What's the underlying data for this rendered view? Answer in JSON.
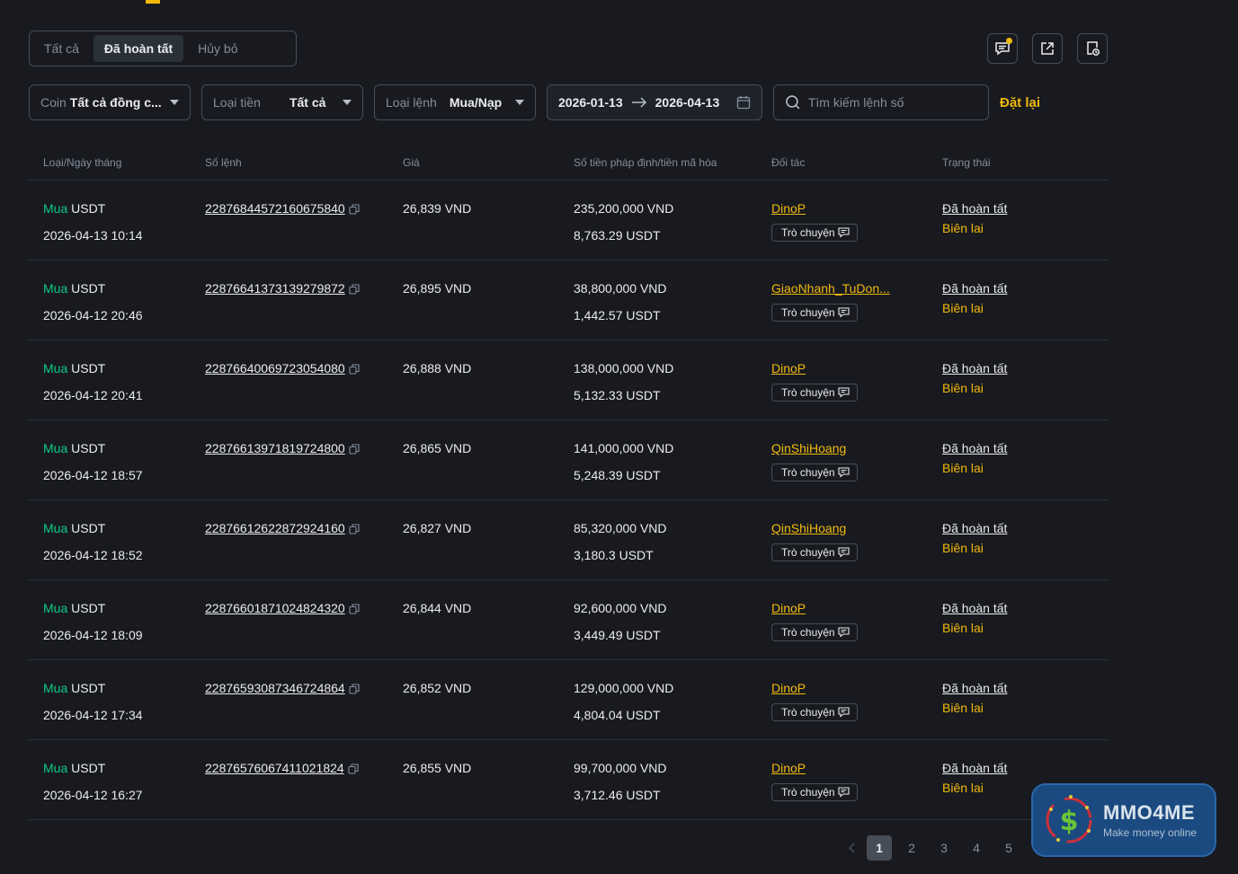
{
  "tabs": [
    {
      "label": "Tất cả",
      "active": false
    },
    {
      "label": "Đã hoàn tất",
      "active": true
    },
    {
      "label": "Hủy bỏ",
      "active": false
    }
  ],
  "filters": {
    "coin": {
      "label": "Coin",
      "value": "Tất cả đồng c..."
    },
    "fiat": {
      "label": "Loại tiền",
      "value": "Tất cả"
    },
    "order_type": {
      "label": "Loại lệnh",
      "value": "Mua/Nạp"
    },
    "date_from": "2026-01-13",
    "date_to": "2026-04-13",
    "search_placeholder": "Tìm kiếm lệnh số",
    "reset_label": "Đặt lại"
  },
  "columns": [
    "Loại/Ngày tháng",
    "Số lệnh",
    "Giá",
    "Số tiền pháp định/tiền mã hóa",
    "Đối tác",
    "Trạng thái"
  ],
  "chat_label": "Trò chuyện",
  "orders": [
    {
      "side": "Mua",
      "asset": "USDT",
      "datetime": "2026-04-13 10:14",
      "order_no": "22876844572160675840",
      "price": "26,839 VND",
      "fiat_amount": "235,200,000 VND",
      "crypto_amount": "8,763.29 USDT",
      "partner": "DinoP",
      "status": "Đã hoàn tất",
      "receipt": "Biên lai"
    },
    {
      "side": "Mua",
      "asset": "USDT",
      "datetime": "2026-04-12 20:46",
      "order_no": "22876641373139279872",
      "price": "26,895 VND",
      "fiat_amount": "38,800,000 VND",
      "crypto_amount": "1,442.57 USDT",
      "partner": "GiaoNhanh_TuDon...",
      "status": "Đã hoàn tất",
      "receipt": "Biên lai"
    },
    {
      "side": "Mua",
      "asset": "USDT",
      "datetime": "2026-04-12 20:41",
      "order_no": "22876640069723054080",
      "price": "26,888 VND",
      "fiat_amount": "138,000,000 VND",
      "crypto_amount": "5,132.33 USDT",
      "partner": "DinoP",
      "status": "Đã hoàn tất",
      "receipt": "Biên lai"
    },
    {
      "side": "Mua",
      "asset": "USDT",
      "datetime": "2026-04-12 18:57",
      "order_no": "22876613971819724800",
      "price": "26,865 VND",
      "fiat_amount": "141,000,000 VND",
      "crypto_amount": "5,248.39 USDT",
      "partner": "QinShiHoang",
      "status": "Đã hoàn tất",
      "receipt": "Biên lai"
    },
    {
      "side": "Mua",
      "asset": "USDT",
      "datetime": "2026-04-12 18:52",
      "order_no": "22876612622872924160",
      "price": "26,827 VND",
      "fiat_amount": "85,320,000 VND",
      "crypto_amount": "3,180.3 USDT",
      "partner": "QinShiHoang",
      "status": "Đã hoàn tất",
      "receipt": "Biên lai"
    },
    {
      "side": "Mua",
      "asset": "USDT",
      "datetime": "2026-04-12 18:09",
      "order_no": "22876601871024824320",
      "price": "26,844 VND",
      "fiat_amount": "92,600,000 VND",
      "crypto_amount": "3,449.49 USDT",
      "partner": "DinoP",
      "status": "Đã hoàn tất",
      "receipt": "Biên lai"
    },
    {
      "side": "Mua",
      "asset": "USDT",
      "datetime": "2026-04-12 17:34",
      "order_no": "22876593087346724864",
      "price": "26,852 VND",
      "fiat_amount": "129,000,000 VND",
      "crypto_amount": "4,804.04 USDT",
      "partner": "DinoP",
      "status": "Đã hoàn tất",
      "receipt": "Biên lai"
    },
    {
      "side": "Mua",
      "asset": "USDT",
      "datetime": "2026-04-12 16:27",
      "order_no": "22876576067411021824",
      "price": "26,855 VND",
      "fiat_amount": "99,700,000 VND",
      "crypto_amount": "3,712.46 USDT",
      "partner": "DinoP",
      "status": "Đã hoàn tất",
      "receipt": "Biên lai"
    }
  ],
  "pagination": {
    "pages": [
      "1",
      "2",
      "3",
      "4",
      "5"
    ],
    "current": "1"
  },
  "watermark": {
    "name": "MMO4ME",
    "tagline": "Make money online"
  },
  "colors": {
    "accent": "#f0b90b",
    "buy": "#0ecb81",
    "background": "#181a20"
  }
}
